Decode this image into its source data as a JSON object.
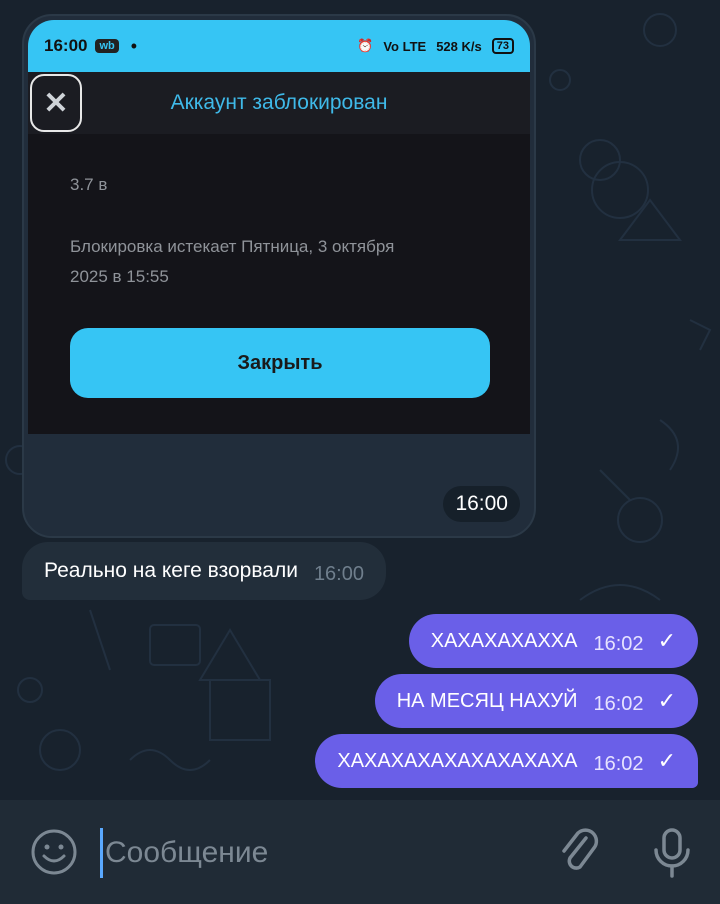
{
  "colors": {
    "chat_background": "#18222d",
    "incoming_bubble": "#222e3a",
    "outgoing_bubble": "#6a5fe8",
    "accent": "#36c5f4"
  },
  "screenshot": {
    "status_bar": {
      "time": "16:00",
      "chip": "wb",
      "right_text": "Vo LTE",
      "speed": "528 K/s",
      "battery": "73"
    },
    "dialog": {
      "title": "Аккаунт заблокирован",
      "close_icon": "close-icon",
      "version": "3.7 в",
      "expiry_line1": "Блокировка истекает Пятница, 3 октября",
      "expiry_line2": "2025 в 15:55",
      "action_label": "Закрыть"
    },
    "time": "16:00"
  },
  "incoming": {
    "text": "Реально на кеге взорвали",
    "time": "16:00"
  },
  "outgoing": [
    {
      "text": "ХАХАХАХАХХА",
      "time": "16:02"
    },
    {
      "text": "НА МЕСЯЦ НАХУЙ",
      "time": "16:02"
    },
    {
      "text": "ХАХАХАХАХАХАХАХАХА",
      "time": "16:02"
    }
  ],
  "composer": {
    "placeholder": "Сообщение",
    "emoji_icon": "smile-icon",
    "attach_icon": "paperclip-icon",
    "mic_icon": "microphone-icon"
  }
}
